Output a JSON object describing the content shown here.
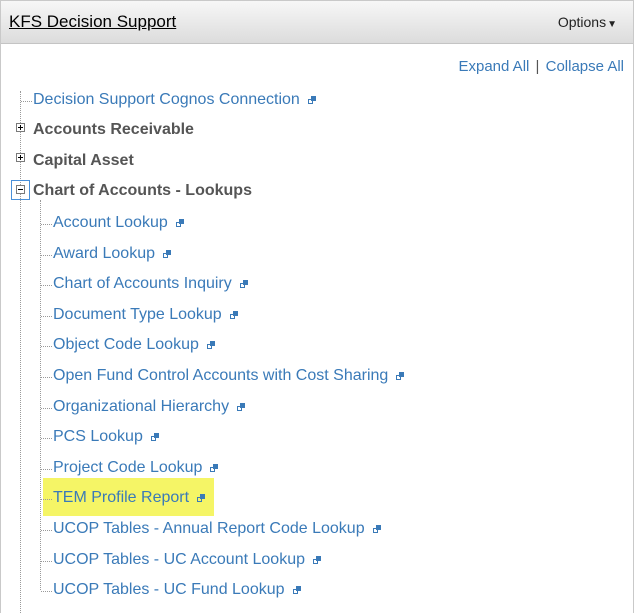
{
  "header": {
    "title": "KFS Decision Support",
    "options_label": "Options"
  },
  "actions": {
    "expand_all": "Expand All",
    "separator": "|",
    "collapse_all": "Collapse All"
  },
  "tree": {
    "top_link": "Decision Support Cognos Connection",
    "folders": [
      "Accounts Receivable",
      "Capital Asset",
      "Chart of Accounts - Lookups"
    ],
    "children": [
      "Account Lookup",
      "Award Lookup",
      "Chart of Accounts Inquiry",
      "Document Type Lookup",
      "Object Code Lookup",
      "Open Fund Control Accounts with Cost Sharing",
      "Organizational Hierarchy",
      "PCS Lookup",
      "Project Code Lookup",
      "TEM Profile Report",
      "UCOP Tables - Annual Report Code Lookup",
      "UCOP Tables - UC Account Lookup",
      "UCOP Tables - UC Fund Lookup"
    ],
    "highlighted_item": "TEM Profile Report",
    "icons": {
      "folder_collapsed": "plus-box-icon",
      "folder_expanded": "minus-box-icon",
      "link": "external-link-icon"
    },
    "colors": {
      "link": "#3a7ab8",
      "folder": "#555555",
      "highlight": "#f5f566"
    }
  }
}
